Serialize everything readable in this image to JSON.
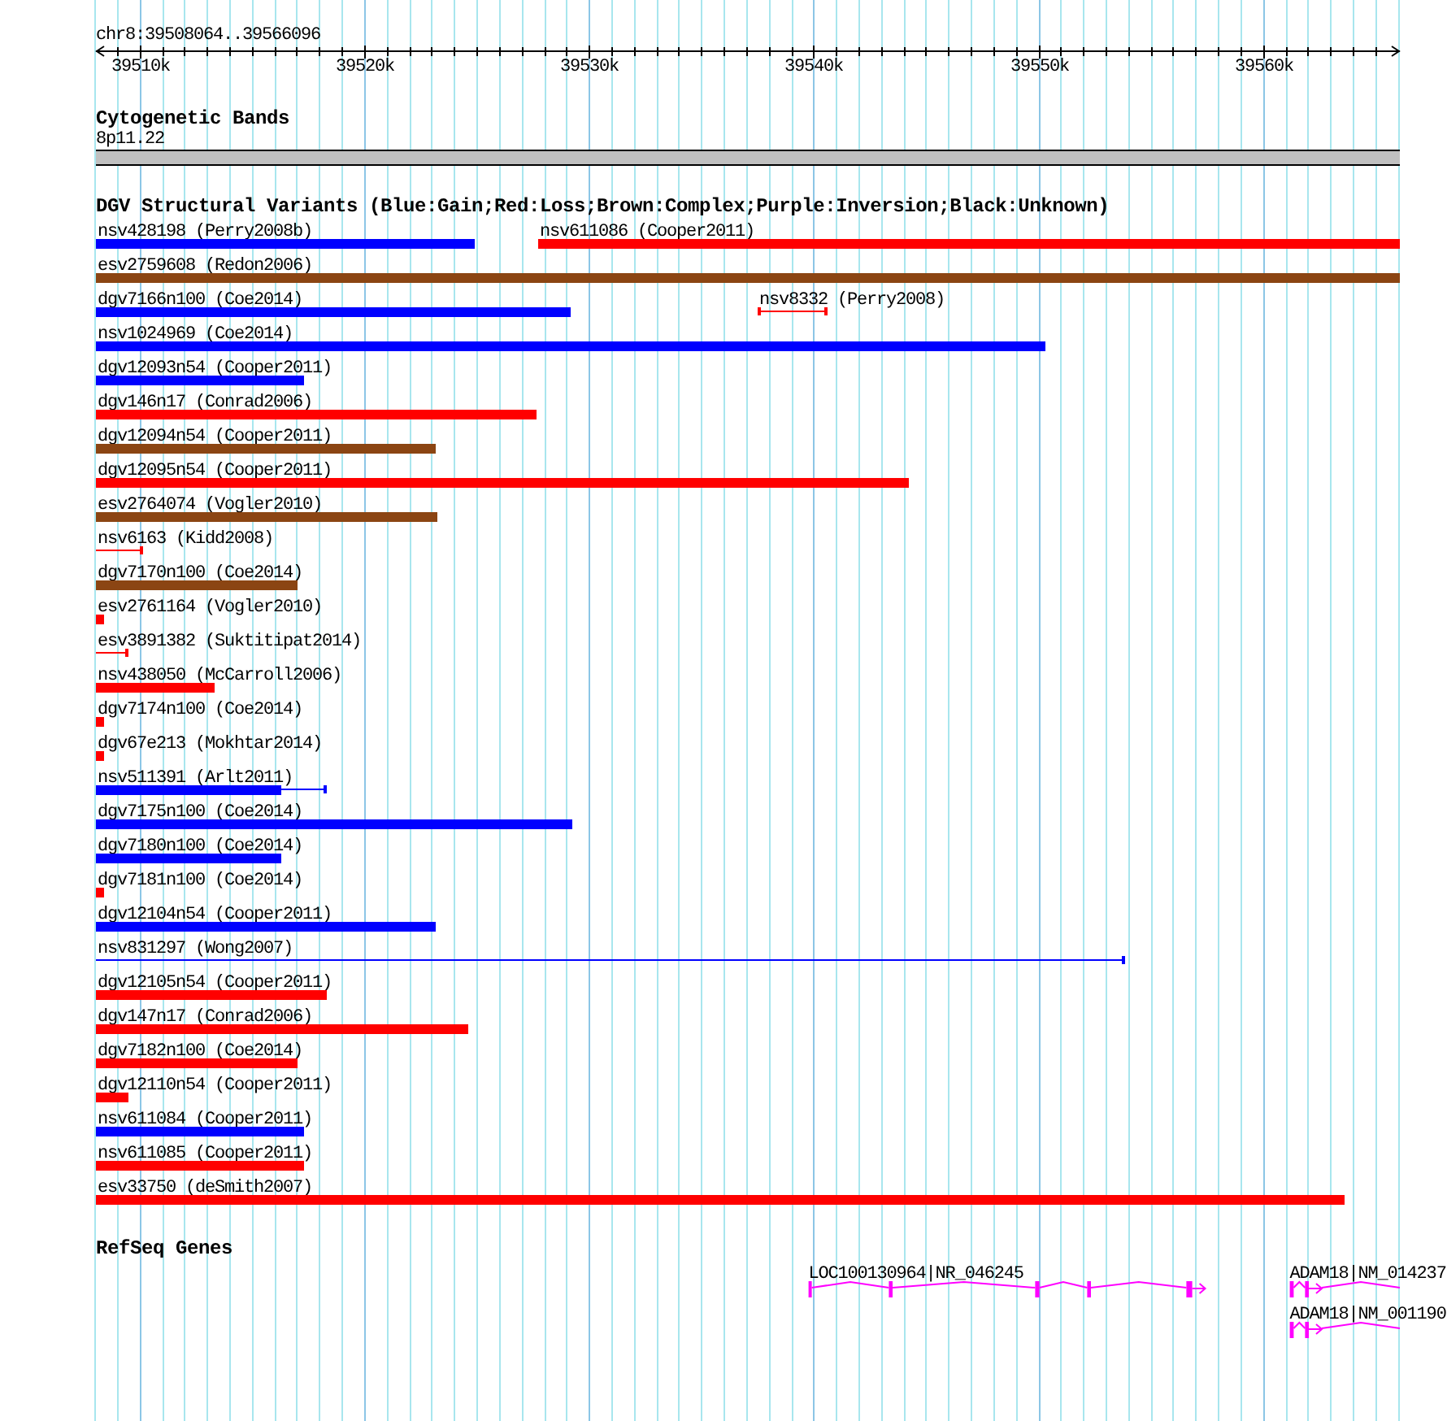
{
  "browser": {
    "region": "chr8:39508064..39566096",
    "ruler_ticks": [
      "39510k",
      "39520k",
      "39530k",
      "39540k",
      "39550k",
      "39560k"
    ],
    "tracks": [
      {
        "kind": "cytoband",
        "title": "Cytogenetic Bands",
        "band": "8p11.22"
      },
      {
        "kind": "variants",
        "title": "DGV Structural Variants (Blue:Gain;Red:Loss;Brown:Complex;Purple:Inversion;Black:Unknown)",
        "features": [
          {
            "label": "nsv428198 (Perry2008b)",
            "color": "#0000ff",
            "kind": "bar"
          },
          {
            "label": "nsv611086 (Cooper2011)",
            "color": "#ff0000",
            "kind": "bar"
          },
          {
            "label": "esv2759608 (Redon2006)",
            "color": "#8b4513",
            "kind": "bar"
          },
          {
            "label": "dgv7166n100 (Coe2014)",
            "color": "#0000ff",
            "kind": "bar"
          },
          {
            "label": "nsv8332 (Perry2008)",
            "color": "#ff0000",
            "kind": "range"
          },
          {
            "label": "nsv1024969 (Coe2014)",
            "color": "#0000ff",
            "kind": "bar"
          },
          {
            "label": "dgv12093n54 (Cooper2011)",
            "color": "#0000ff",
            "kind": "bar"
          },
          {
            "label": "dgv146n17 (Conrad2006)",
            "color": "#ff0000",
            "kind": "bar"
          },
          {
            "label": "dgv12094n54 (Cooper2011)",
            "color": "#8b4513",
            "kind": "bar"
          },
          {
            "label": "dgv12095n54 (Cooper2011)",
            "color": "#ff0000",
            "kind": "bar"
          },
          {
            "label": "esv2764074 (Vogler2010)",
            "color": "#8b4513",
            "kind": "bar"
          },
          {
            "label": "nsv6163 (Kidd2008)",
            "color": "#ff0000",
            "kind": "range"
          },
          {
            "label": "dgv7170n100 (Coe2014)",
            "color": "#8b4513",
            "kind": "bar"
          },
          {
            "label": "esv2761164 (Vogler2010)",
            "color": "#ff0000",
            "kind": "bar"
          },
          {
            "label": "esv3891382 (Suktitipat2014)",
            "color": "#ff0000",
            "kind": "range"
          },
          {
            "label": "nsv438050 (McCarroll2006)",
            "color": "#ff0000",
            "kind": "bar"
          },
          {
            "label": "dgv7174n100 (Coe2014)",
            "color": "#ff0000",
            "kind": "bar"
          },
          {
            "label": "dgv67e213 (Mokhtar2014)",
            "color": "#ff0000",
            "kind": "bar"
          },
          {
            "label": "nsv511391 (Arlt2011)",
            "color": "#0000ff",
            "kind": "bar_range"
          },
          {
            "label": "dgv7175n100 (Coe2014)",
            "color": "#0000ff",
            "kind": "bar"
          },
          {
            "label": "dgv7180n100 (Coe2014)",
            "color": "#0000ff",
            "kind": "bar"
          },
          {
            "label": "dgv7181n100 (Coe2014)",
            "color": "#ff0000",
            "kind": "bar"
          },
          {
            "label": "dgv12104n54 (Cooper2011)",
            "color": "#0000ff",
            "kind": "bar"
          },
          {
            "label": "nsv831297 (Wong2007)",
            "color": "#0000ff",
            "kind": "range"
          },
          {
            "label": "dgv12105n54 (Cooper2011)",
            "color": "#ff0000",
            "kind": "bar"
          },
          {
            "label": "dgv147n17 (Conrad2006)",
            "color": "#ff0000",
            "kind": "bar"
          },
          {
            "label": "dgv7182n100 (Coe2014)",
            "color": "#ff0000",
            "kind": "bar"
          },
          {
            "label": "dgv12110n54 (Cooper2011)",
            "color": "#ff0000",
            "kind": "bar"
          },
          {
            "label": "nsv611084 (Cooper2011)",
            "color": "#0000ff",
            "kind": "bar"
          },
          {
            "label": "nsv611085 (Cooper2011)",
            "color": "#ff0000",
            "kind": "bar"
          },
          {
            "label": "esv33750 (deSmith2007)",
            "color": "#ff0000",
            "kind": "bar"
          }
        ]
      },
      {
        "kind": "genes",
        "title": "RefSeq Genes",
        "features": [
          {
            "label": "LOC100130964|NR_046245"
          },
          {
            "label": "ADAM18|NM_014237"
          },
          {
            "label": "ADAM18|NM_001190"
          }
        ]
      }
    ]
  }
}
